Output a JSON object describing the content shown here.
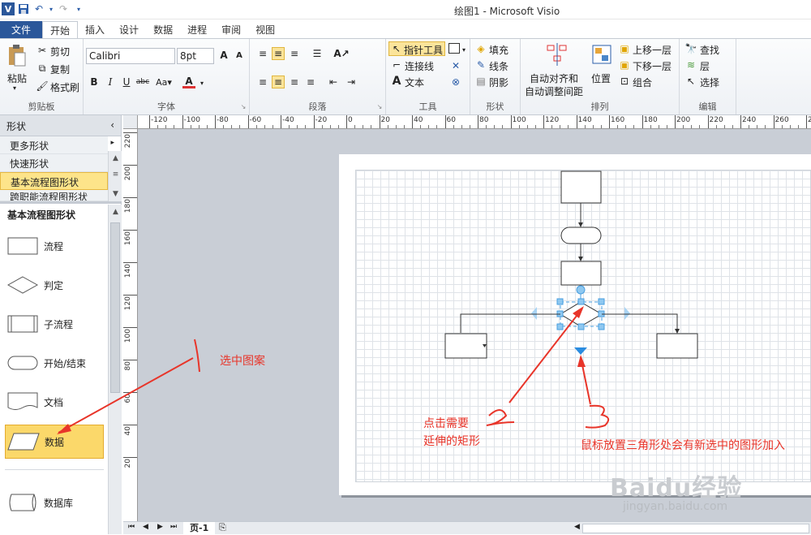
{
  "window": {
    "title": "绘图1 - Microsoft Visio"
  },
  "tabs": [
    {
      "label": "文件"
    },
    {
      "label": "开始"
    },
    {
      "label": "插入"
    },
    {
      "label": "设计"
    },
    {
      "label": "数据"
    },
    {
      "label": "进程"
    },
    {
      "label": "审阅"
    },
    {
      "label": "视图"
    }
  ],
  "clipboard": {
    "paste": "粘贴",
    "cut": "剪切",
    "copy": "复制",
    "format_painter": "格式刷",
    "label": "剪贴板"
  },
  "font": {
    "name": "Calibri",
    "size": "8pt",
    "label": "字体"
  },
  "paragraph": {
    "label": "段落"
  },
  "tools": {
    "pointer": "指针工具",
    "connector": "连接线",
    "text": "文本",
    "label": "工具"
  },
  "shape_group": {
    "fill": "填充",
    "line": "线条",
    "shadow": "阴影",
    "label": "形状"
  },
  "arrange": {
    "auto_align": "自动对齐和",
    "auto_space": "自动调整间距",
    "position": "位置",
    "bring_forward": "上移一层",
    "send_backward": "下移一层",
    "group": "组合",
    "label": "排列"
  },
  "editing": {
    "find": "查找",
    "layer": "层",
    "select": "选择",
    "label": "编辑"
  },
  "shapes_panel": {
    "title": "形状",
    "more": "更多形状",
    "quick": "快速形状",
    "basic": "基本流程图形状",
    "cross": "跨职能流程图形状",
    "stencil_title": "基本流程图形状",
    "items": [
      {
        "label": "流程",
        "icon": "process-shape-icon"
      },
      {
        "label": "判定",
        "icon": "decision-shape-icon"
      },
      {
        "label": "子流程",
        "icon": "subprocess-shape-icon"
      },
      {
        "label": "开始/结束",
        "icon": "terminator-shape-icon"
      },
      {
        "label": "文档",
        "icon": "document-shape-icon"
      },
      {
        "label": "数据",
        "icon": "data-shape-icon"
      },
      {
        "label": "数据库",
        "icon": "database-shape-icon"
      }
    ]
  },
  "ruler_h": [
    "-120",
    "-100",
    "-80",
    "-60",
    "-40",
    "-20",
    "0",
    "20",
    "40",
    "60",
    "80",
    "100",
    "120",
    "140",
    "160",
    "180",
    "200",
    "220",
    "240",
    "260",
    "280"
  ],
  "ruler_v": [
    "220",
    "200",
    "180",
    "160",
    "140",
    "120",
    "100",
    "80",
    "60",
    "40",
    "20"
  ],
  "page_tab": {
    "label": "页-1"
  },
  "annotations": {
    "a1": "选中图案",
    "a2": "点击需要\n延伸的矩形",
    "a3": "鼠标放置三角形处会有新选中的图形加入"
  },
  "watermark": {
    "brand": "Baidu经验",
    "url": "jingyan.baidu.com"
  },
  "colors": {
    "accent": "#2b579a",
    "highlight": "#fbd86a",
    "annotation": "#e8352a",
    "selection": "#4a9fe0"
  }
}
